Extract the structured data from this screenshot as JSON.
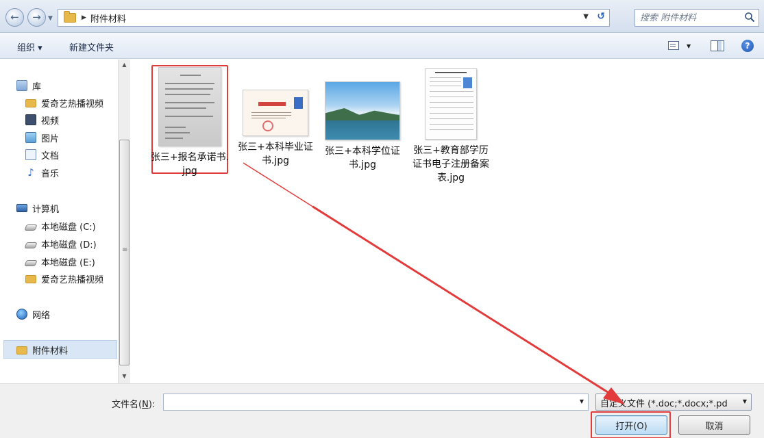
{
  "address_bar": {
    "path_segment": "附件材料",
    "search_placeholder": "搜索 附件材料"
  },
  "toolbar": {
    "organize_label": "组织 ▾",
    "new_folder_label": "新建文件夹"
  },
  "nav": {
    "library": "库",
    "library_items": [
      "爱奇艺热播视频",
      "视频",
      "图片",
      "文档",
      "音乐"
    ],
    "computer": "计算机",
    "computer_items": [
      "本地磁盘 (C:)",
      "本地磁盘 (D:)",
      "本地磁盘 (E:)",
      "爱奇艺热播视频"
    ],
    "network": "网络",
    "current_folder": "附件材料"
  },
  "files": [
    {
      "name": "张三+报名承诺书.jpg",
      "selected": true
    },
    {
      "name": "张三+本科毕业证书.jpg",
      "selected": false
    },
    {
      "name": "张三+本科学位证书.jpg",
      "selected": false
    },
    {
      "name": "张三+教育部学历证书电子注册备案表.jpg",
      "selected": false
    }
  ],
  "bottom": {
    "filename_label_prefix": "文件名(",
    "filename_label_key": "N",
    "filename_label_suffix": "):",
    "filename_value": "",
    "filetype_value": "自定义文件 (*.doc;*.docx;*.pd",
    "open_label": "打开(O)",
    "cancel_label": "取消"
  },
  "colors": {
    "annotation_red": "#e23b3b",
    "folder_yellow": "#e7b94a",
    "selection_blue": "#d8e6f5"
  },
  "icons": [
    "back-arrow-icon",
    "forward-arrow-icon",
    "folder-icon",
    "refresh-icon",
    "search-icon",
    "view-icon",
    "preview-pane-icon",
    "help-icon",
    "library-icon",
    "video-icon",
    "picture-icon",
    "document-icon",
    "music-icon",
    "computer-icon",
    "disk-icon",
    "network-icon"
  ]
}
